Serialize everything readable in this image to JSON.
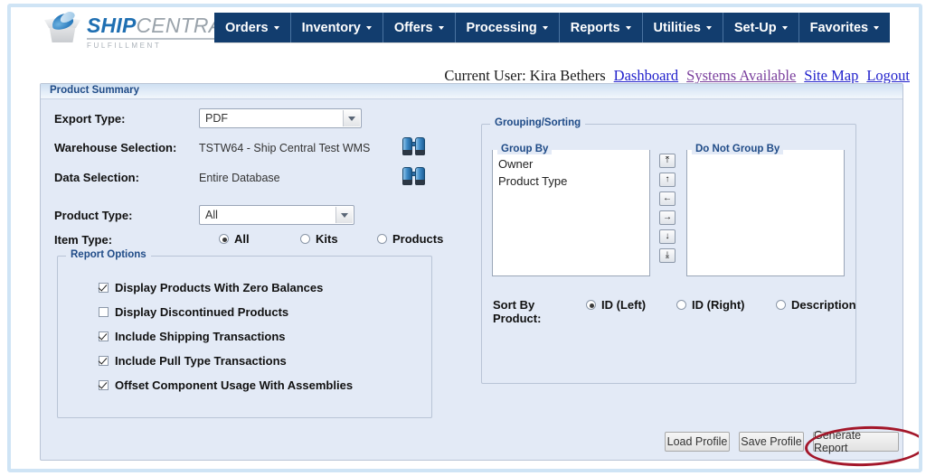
{
  "brand": {
    "logo_icon": "shipping-box-icon",
    "name_bold": "SHIP",
    "name_light": "CENTRAL",
    "tagline": "FULFILLMENT"
  },
  "nav": {
    "items": [
      {
        "label": "Orders",
        "caret": true
      },
      {
        "label": "Inventory",
        "caret": true
      },
      {
        "label": "Offers",
        "caret": true
      },
      {
        "label": "Processing",
        "caret": true
      },
      {
        "label": "Reports",
        "caret": true
      },
      {
        "label": "Utilities",
        "caret": true
      },
      {
        "label": "Set-Up",
        "caret": true
      },
      {
        "label": "Favorites",
        "caret": true
      }
    ]
  },
  "userbar": {
    "current_user_label": "Current User: Kira Bethers",
    "links": [
      {
        "label": "Dashboard",
        "visited": false
      },
      {
        "label": "Systems Available",
        "visited": true
      },
      {
        "label": "Site Map",
        "visited": false
      },
      {
        "label": "Logout",
        "visited": false
      }
    ]
  },
  "panel": {
    "title": "Product Summary",
    "export_type": {
      "label": "Export Type:",
      "value": "PDF"
    },
    "warehouse_selection": {
      "label": "Warehouse Selection:",
      "value": "TSTW64 - Ship Central Test WMS",
      "lookup_icon": "binoculars-icon"
    },
    "data_selection": {
      "label": "Data Selection:",
      "value": "Entire Database",
      "lookup_icon": "binoculars-icon"
    },
    "product_type": {
      "label": "Product Type:",
      "value": "All"
    },
    "item_type": {
      "label": "Item Type:",
      "options": [
        {
          "label": "All",
          "selected": true
        },
        {
          "label": "Kits",
          "selected": false
        },
        {
          "label": "Products",
          "selected": false
        }
      ]
    },
    "report_options": {
      "legend": "Report Options",
      "items": [
        {
          "label": "Display Products With Zero Balances",
          "checked": true
        },
        {
          "label": "Display Discontinued Products",
          "checked": false
        },
        {
          "label": "Include Shipping Transactions",
          "checked": true
        },
        {
          "label": "Include Pull Type Transactions",
          "checked": true
        },
        {
          "label": "Offset Component Usage With Assemblies",
          "checked": true
        }
      ]
    },
    "grouping_sorting": {
      "legend": "Grouping/Sorting",
      "group_by": {
        "legend": "Group By",
        "items": [
          "Owner",
          "Product Type"
        ]
      },
      "do_not_group_by": {
        "legend": "Do Not Group By",
        "items": []
      },
      "transfer_buttons": [
        {
          "icon": "move-to-top-icon",
          "glyph": "⤒"
        },
        {
          "icon": "move-up-icon",
          "glyph": "↑"
        },
        {
          "icon": "move-left-icon",
          "glyph": "←"
        },
        {
          "icon": "move-right-icon",
          "glyph": "→"
        },
        {
          "icon": "move-down-icon",
          "glyph": "↓"
        },
        {
          "icon": "move-to-bottom-icon",
          "glyph": "⤓"
        }
      ],
      "sort_by_product": {
        "label_line1": "Sort By",
        "label_line2": "Product:",
        "options": [
          {
            "label": "ID (Left)",
            "selected": true
          },
          {
            "label": "ID (Right)",
            "selected": false
          },
          {
            "label": "Description",
            "selected": false
          }
        ]
      }
    },
    "actions": [
      {
        "label": "Load Profile"
      },
      {
        "label": "Save Profile"
      },
      {
        "label": "Generate Report"
      }
    ]
  },
  "annotation": {
    "shape": "ellipse",
    "color": "#a3172a",
    "targets": "Generate Report"
  }
}
